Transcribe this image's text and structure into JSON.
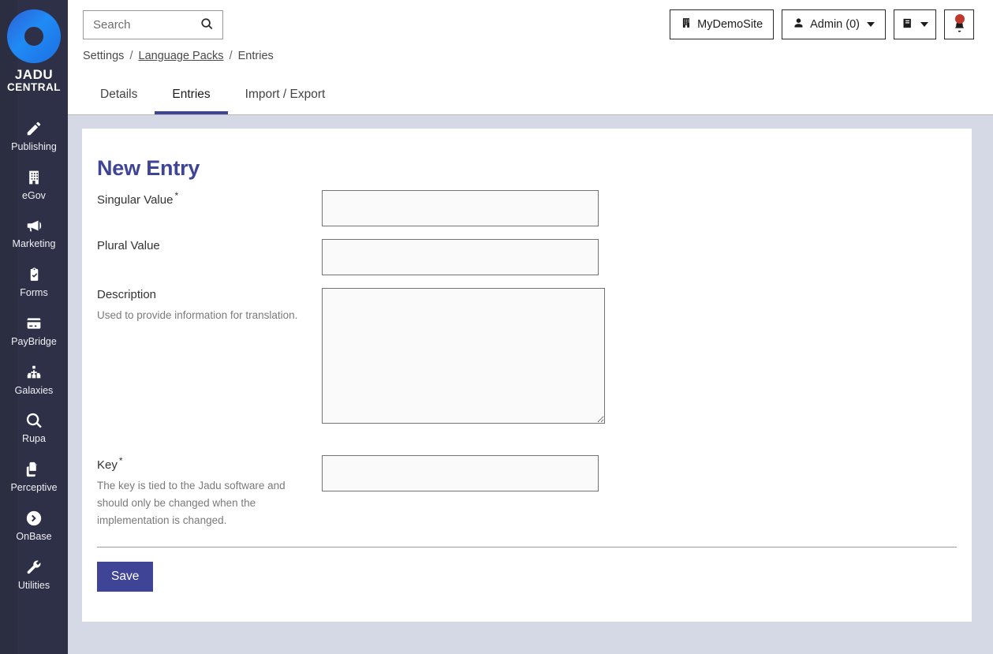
{
  "brand": {
    "logo_line1": "JADU",
    "logo_line2": "CENTRAL",
    "accent": "#3f4497",
    "sidebar_bg": "#2e3047",
    "page_bg": "#d5d8e5",
    "alert_color": "#c0392b"
  },
  "sidebar": {
    "items": [
      {
        "label": "Publishing",
        "icon": "pencil-icon"
      },
      {
        "label": "eGov",
        "icon": "building-icon"
      },
      {
        "label": "Marketing",
        "icon": "megaphone-icon"
      },
      {
        "label": "Forms",
        "icon": "clipboard-check-icon"
      },
      {
        "label": "PayBridge",
        "icon": "credit-card-icon"
      },
      {
        "label": "Galaxies",
        "icon": "sitemap-icon"
      },
      {
        "label": "Rupa",
        "icon": "magnifier-icon"
      },
      {
        "label": "Perceptive",
        "icon": "documents-icon"
      },
      {
        "label": "OnBase",
        "icon": "circle-chevron-right-icon"
      },
      {
        "label": "Utilities",
        "icon": "wrench-icon"
      }
    ]
  },
  "search": {
    "placeholder": "Search",
    "value": "",
    "button_icon": "search-icon"
  },
  "breadcrumb": {
    "items": [
      {
        "label": "Settings",
        "link": false
      },
      {
        "label": "Language Packs",
        "link": true
      },
      {
        "label": "Entries",
        "link": false
      }
    ],
    "separator": "/"
  },
  "topbar": {
    "site_button": {
      "label": "MyDemoSite",
      "icon": "building-icon"
    },
    "user_button": {
      "label": "Admin (0)",
      "icon": "user-icon",
      "caret": true
    },
    "manual_button": {
      "label": "",
      "icon": "book-icon",
      "caret": true
    },
    "notifications_button": {
      "label": "",
      "icon": "bell-icon",
      "has_alert": true
    }
  },
  "tabs": [
    {
      "label": "Details",
      "active": false
    },
    {
      "label": "Entries",
      "active": true
    },
    {
      "label": "Import / Export",
      "active": false
    }
  ],
  "main": {
    "title": "New Entry",
    "fields": [
      {
        "label": "Singular Value",
        "required": true,
        "required_mark": "*",
        "help": "",
        "type": "text",
        "value": ""
      },
      {
        "label": "Plural Value",
        "required": false,
        "required_mark": "",
        "help": "",
        "type": "text",
        "value": ""
      },
      {
        "label": "Description",
        "required": false,
        "required_mark": "",
        "help": "Used to provide information for translation.",
        "type": "textarea",
        "value": ""
      },
      {
        "label": "Key",
        "required": true,
        "required_mark": "*",
        "help": "The key is tied to the Jadu software and should only be changed when the implementation is changed.",
        "type": "text",
        "value": ""
      }
    ],
    "save_label": "Save"
  }
}
